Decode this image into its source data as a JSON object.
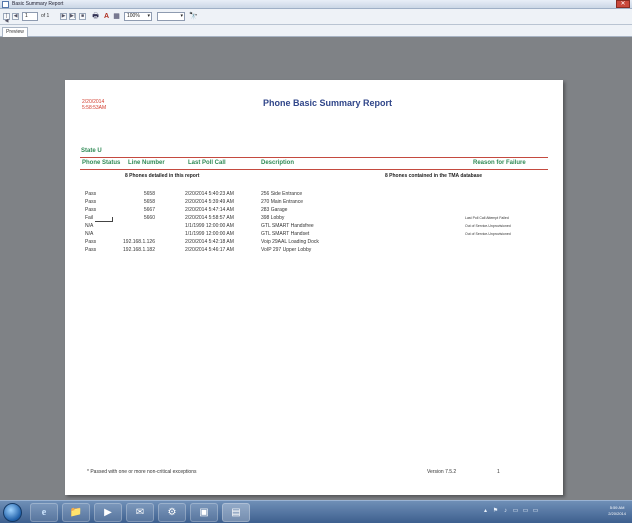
{
  "window": {
    "title": "Basic Summary Report",
    "close_label": "✕"
  },
  "toolbar": {
    "first_page": "|◀",
    "prev_page": "◀",
    "page_input": "1",
    "page_of": "of 1",
    "next_page": "▶",
    "last_page": "▶|",
    "stop": "■",
    "print": "🖶",
    "export": "A",
    "layout": "▦",
    "zoom_value": "100%",
    "zoom_caret": "▾",
    "search_value": "",
    "search_caret": "▾",
    "find": "🔭"
  },
  "tabs": [
    {
      "label": "Preview"
    }
  ],
  "report": {
    "date_line1": "2/20/2014",
    "date_line2": "5:58:53AM",
    "title": "Phone Basic Summary Report",
    "state_label": "State U",
    "columns": {
      "status": "Phone Status",
      "line": "Line Number",
      "poll": "Last Poll Call",
      "desc": "Description",
      "reason": "Reason for Failure"
    },
    "summary_left": "8  Phones detailed in this report",
    "summary_right": "8  Phones contained in the TMA database",
    "rows": [
      {
        "status": "Pass",
        "line": "5658",
        "poll": "2/20/2014  5:40:23 AM",
        "desc": "256 Side Entrance",
        "reason": ""
      },
      {
        "status": "Pass",
        "line": "5658",
        "poll": "2/20/2014  5:39:49 AM",
        "desc": "270 Main Entrance",
        "reason": ""
      },
      {
        "status": "Pass",
        "line": "5667",
        "poll": "2/20/2014  5:47:14 AM",
        "desc": "283 Garage",
        "reason": ""
      },
      {
        "status": "Fail",
        "line": "5660",
        "poll": "2/20/2014  5:58:57 AM",
        "desc": "398 Lobby",
        "reason": "Last Poll Call Attempt Failed"
      },
      {
        "status": "N/A",
        "line": "",
        "poll": "1/1/1999  12:00:00 AM",
        "desc": "GTL SMART Handsfree",
        "reason": "Out of Service-Unprovisioned"
      },
      {
        "status": "N/A",
        "line": "",
        "poll": "1/1/1999  12:00:00 AM",
        "desc": "GTL SMART Handset",
        "reason": "Out of Service-Unprovisioned"
      },
      {
        "status": "Pass",
        "line": "192.168.1.126",
        "poll": "2/20/2014  5:42:18 AM",
        "desc": "Voip 29AAL Loading Dock",
        "reason": ""
      },
      {
        "status": "Pass",
        "line": "192.168.1.182",
        "poll": "2/20/2014  5:46:17 AM",
        "desc": "VoIP 297 Upper Lobby",
        "reason": ""
      }
    ],
    "footer_note": "* Passed with one or more non-critical exceptions",
    "footer_version": "Version 7.5.2",
    "footer_page": "1"
  },
  "taskbar": {
    "apps": [
      "e",
      "📁",
      "▶",
      "✉",
      "⚙",
      "▣",
      "▤"
    ],
    "clock_time": "5:59 AM",
    "clock_date": "2/20/2014",
    "tray": [
      "▴",
      "⚑",
      "♪",
      "▭",
      "▭",
      "▭"
    ]
  }
}
